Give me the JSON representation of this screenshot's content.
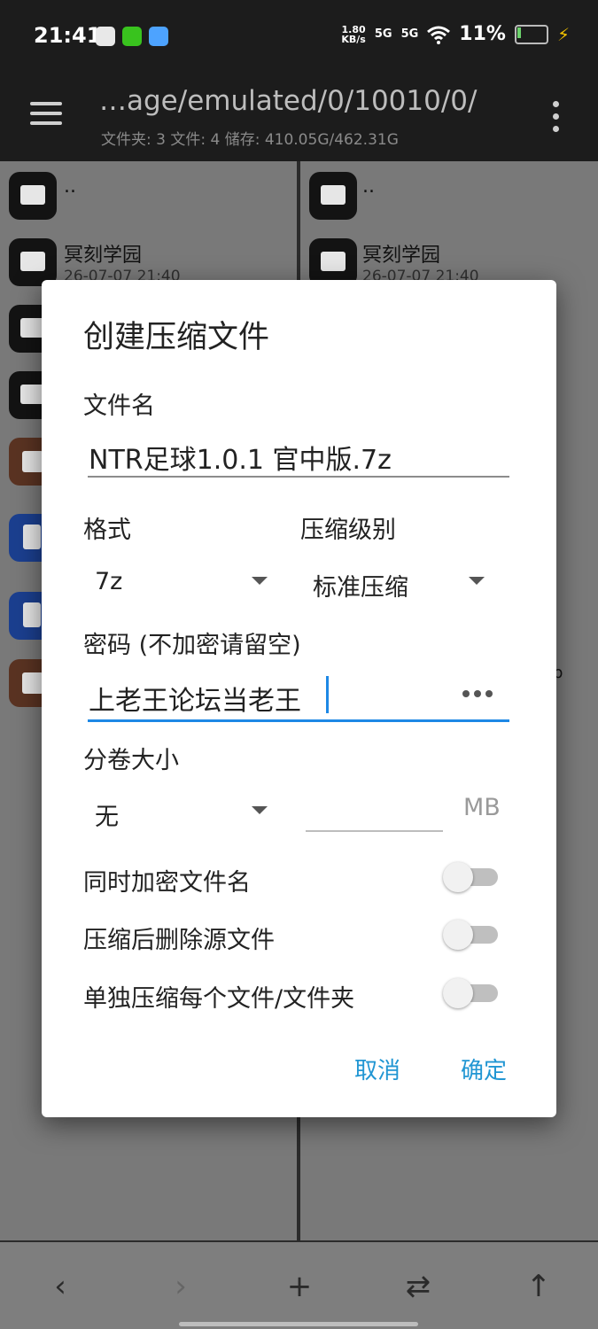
{
  "status_bar": {
    "time": "21:41",
    "net_speed_value": "1.80",
    "net_speed_unit": "KB/s",
    "signal_1": "5G",
    "signal_2": "5G",
    "battery": "11%"
  },
  "toolbar": {
    "path": "…age/emulated/0/10010/0/",
    "info": "文件夹: 3  文件: 4  储存: 410.05G/462.31G"
  },
  "left_panel": {
    "parent": "..",
    "item_name": "冥刻学园",
    "item_date": "26-07-07 21:40"
  },
  "right_panel": {
    "parent": "..",
    "item_name": "冥刻学园",
    "item_date": "26-07-07 21:40",
    "fragment": "p"
  },
  "dialog": {
    "title": "创建压缩文件",
    "filename_label": "文件名",
    "filename_value": "NTR足球1.0.1 官中版.7z",
    "format_label": "格式",
    "format_value": "7z",
    "level_label": "压缩级别",
    "level_value": "标准压缩",
    "password_label": "密码 (不加密请留空)",
    "password_value": "上老王论坛当老王",
    "split_label": "分卷大小",
    "split_value": "无",
    "split_unit": "MB",
    "encrypt_names_label": "同时加密文件名",
    "delete_source_label": "压缩后删除源文件",
    "separate_label": "单独压缩每个文件/文件夹",
    "cancel": "取消",
    "ok": "确定"
  },
  "bottom_nav": {
    "back": "‹",
    "forward": "›",
    "add": "+",
    "swap": "⇄",
    "up": "↑"
  }
}
